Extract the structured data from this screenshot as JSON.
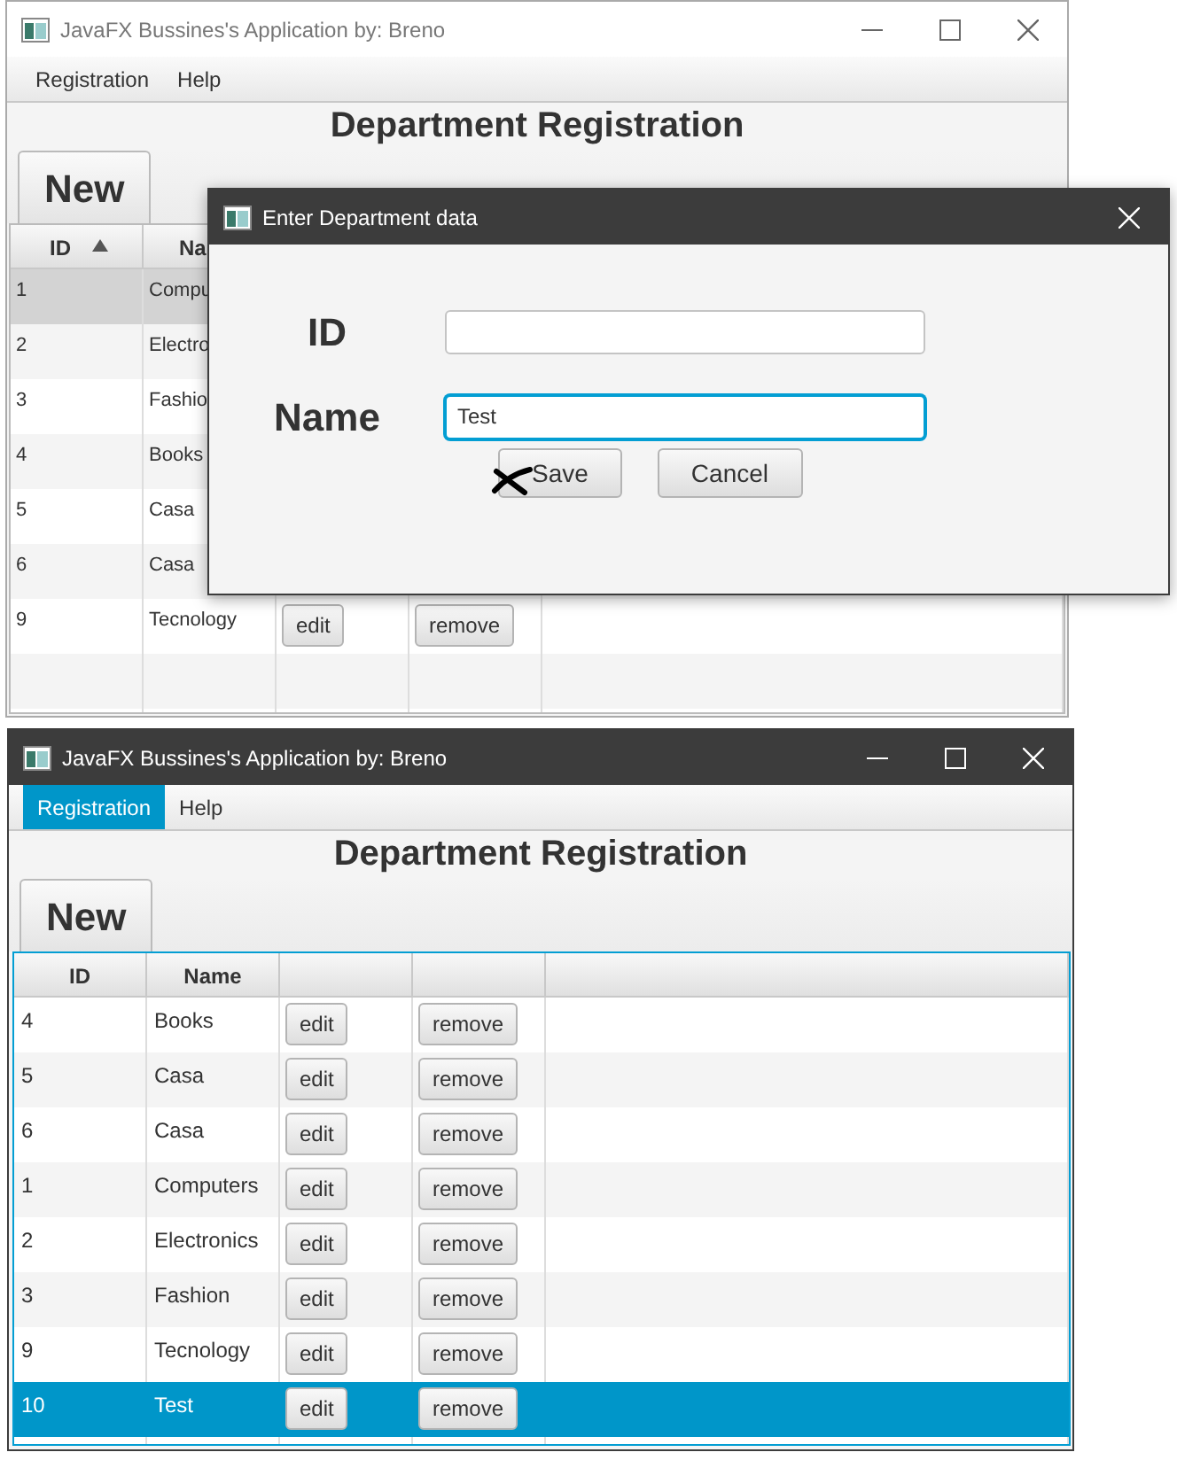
{
  "windows": [
    {
      "title": "JavaFX Bussines's Application by: Breno",
      "active": false,
      "menu": [
        {
          "label": "Registration",
          "selected": false
        },
        {
          "label": "Help",
          "selected": false
        }
      ],
      "heading": "Department Registration",
      "new_button": "New",
      "columns": [
        {
          "label": "ID",
          "sorted": true
        },
        {
          "label": "Na"
        }
      ],
      "rows": [
        {
          "id": "1",
          "name": "Compu",
          "selected": true
        },
        {
          "id": "2",
          "name": "Electro",
          "selected": false
        },
        {
          "id": "3",
          "name": "Fashio",
          "selected": false
        },
        {
          "id": "4",
          "name": "Books",
          "selected": false
        },
        {
          "id": "5",
          "name": "Casa",
          "selected": false
        },
        {
          "id": "6",
          "name": "Casa",
          "selected": false
        },
        {
          "id": "9",
          "name": "Tecnology",
          "selected": false,
          "edit": "edit",
          "remove": "remove"
        }
      ]
    },
    {
      "title": "JavaFX Bussines's Application by: Breno",
      "active": true,
      "menu": [
        {
          "label": "Registration",
          "selected": true
        },
        {
          "label": "Help",
          "selected": false
        }
      ],
      "heading": "Department Registration",
      "new_button": "New",
      "columns": [
        {
          "label": "ID"
        },
        {
          "label": "Name"
        }
      ],
      "rows": [
        {
          "id": "4",
          "name": "Books",
          "selected": false,
          "edit": "edit",
          "remove": "remove"
        },
        {
          "id": "5",
          "name": "Casa",
          "selected": false,
          "edit": "edit",
          "remove": "remove"
        },
        {
          "id": "6",
          "name": "Casa",
          "selected": false,
          "edit": "edit",
          "remove": "remove"
        },
        {
          "id": "1",
          "name": "Computers",
          "selected": false,
          "edit": "edit",
          "remove": "remove"
        },
        {
          "id": "2",
          "name": "Electronics",
          "selected": false,
          "edit": "edit",
          "remove": "remove"
        },
        {
          "id": "3",
          "name": "Fashion",
          "selected": false,
          "edit": "edit",
          "remove": "remove"
        },
        {
          "id": "9",
          "name": "Tecnology",
          "selected": false,
          "edit": "edit",
          "remove": "remove"
        },
        {
          "id": "10",
          "name": "Test",
          "selected": true,
          "edit": "edit",
          "remove": "remove"
        }
      ]
    }
  ],
  "dialog": {
    "title": "Enter Department data",
    "fields": [
      {
        "label": "ID",
        "focused": false
      },
      {
        "label": "Name",
        "value": "Test",
        "focused": true
      }
    ],
    "buttons": [
      "Save",
      "Cancel"
    ]
  }
}
